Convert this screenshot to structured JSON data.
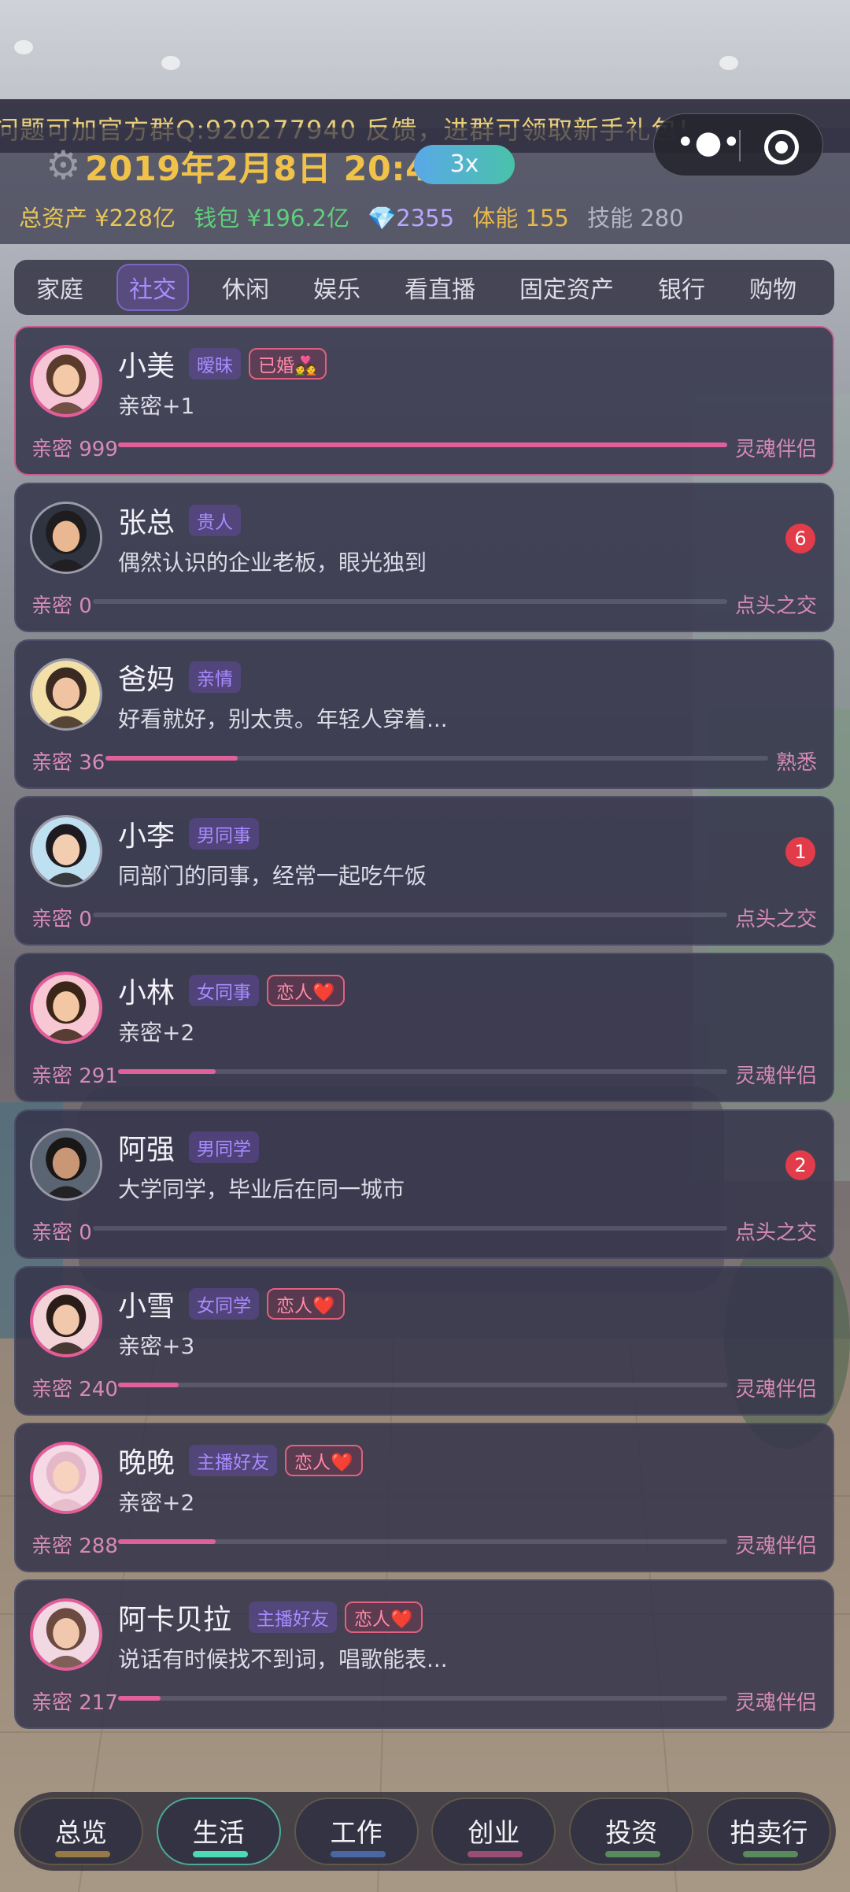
{
  "marquee_text": "问题可加官方群Q:920277940 反馈，进群可领取新手礼包！",
  "header": {
    "date": "2019年2月8日 20:42",
    "speed": "3x",
    "stats": {
      "asset": "总资产 ¥228亿",
      "wallet": "钱包 ¥196.2亿",
      "diamond": "💎2355",
      "stamina": "体能 155",
      "skill": "技能 280"
    }
  },
  "tabs": [
    "家庭",
    "社交",
    "休闲",
    "娱乐",
    "看直播",
    "固定资产",
    "银行",
    "购物"
  ],
  "active_tab": "社交",
  "contacts": [
    {
      "name": "小美",
      "relation": "暧昧",
      "love": "已婚💑",
      "desc": "亲密+1",
      "intimacy": "亲密 999",
      "level": "灵魂伴侣",
      "progress": 1.0,
      "badge": ""
    },
    {
      "name": "张总",
      "relation": "贵人",
      "love": "",
      "desc": "偶然认识的企业老板，眼光独到",
      "intimacy": "亲密 0",
      "level": "点头之交",
      "progress": 0.0,
      "badge": "6"
    },
    {
      "name": "爸妈",
      "relation": "亲情",
      "love": "",
      "desc": "好看就好，别太贵。年轻人穿着...",
      "intimacy": "亲密 36",
      "level": "熟悉",
      "progress": 0.2,
      "badge": ""
    },
    {
      "name": "小李",
      "relation": "男同事",
      "love": "",
      "desc": "同部门的同事，经常一起吃午饭",
      "intimacy": "亲密 0",
      "level": "点头之交",
      "progress": 0.0,
      "badge": "1"
    },
    {
      "name": "小林",
      "relation": "女同事",
      "love": "恋人❤️",
      "desc": "亲密+2",
      "intimacy": "亲密 291",
      "level": "灵魂伴侣",
      "progress": 0.16,
      "badge": ""
    },
    {
      "name": "阿强",
      "relation": "男同学",
      "love": "",
      "desc": "大学同学，毕业后在同一城市",
      "intimacy": "亲密 0",
      "level": "点头之交",
      "progress": 0.0,
      "badge": "2"
    },
    {
      "name": "小雪",
      "relation": "女同学",
      "love": "恋人❤️",
      "desc": "亲密+3",
      "intimacy": "亲密 240",
      "level": "灵魂伴侣",
      "progress": 0.1,
      "badge": ""
    },
    {
      "name": "晚晚",
      "relation": "主播好友",
      "love": "恋人❤️",
      "desc": "亲密+2",
      "intimacy": "亲密 288",
      "level": "灵魂伴侣",
      "progress": 0.16,
      "badge": ""
    },
    {
      "name": "阿卡贝拉",
      "relation": "主播好友",
      "love": "恋人❤️",
      "desc": "说话有时候找不到词，唱歌能表...",
      "intimacy": "亲密 217",
      "level": "灵魂伴侣",
      "progress": 0.07,
      "badge": ""
    }
  ],
  "bottom_nav": [
    "总览",
    "生活",
    "工作",
    "创业",
    "投资",
    "拍卖行"
  ],
  "active_nav": "生活",
  "colors": {
    "accent_pink": "#e0609a",
    "badge_red": "#e23b4a",
    "gold": "#f1c24a",
    "purple": "#a88bff"
  }
}
